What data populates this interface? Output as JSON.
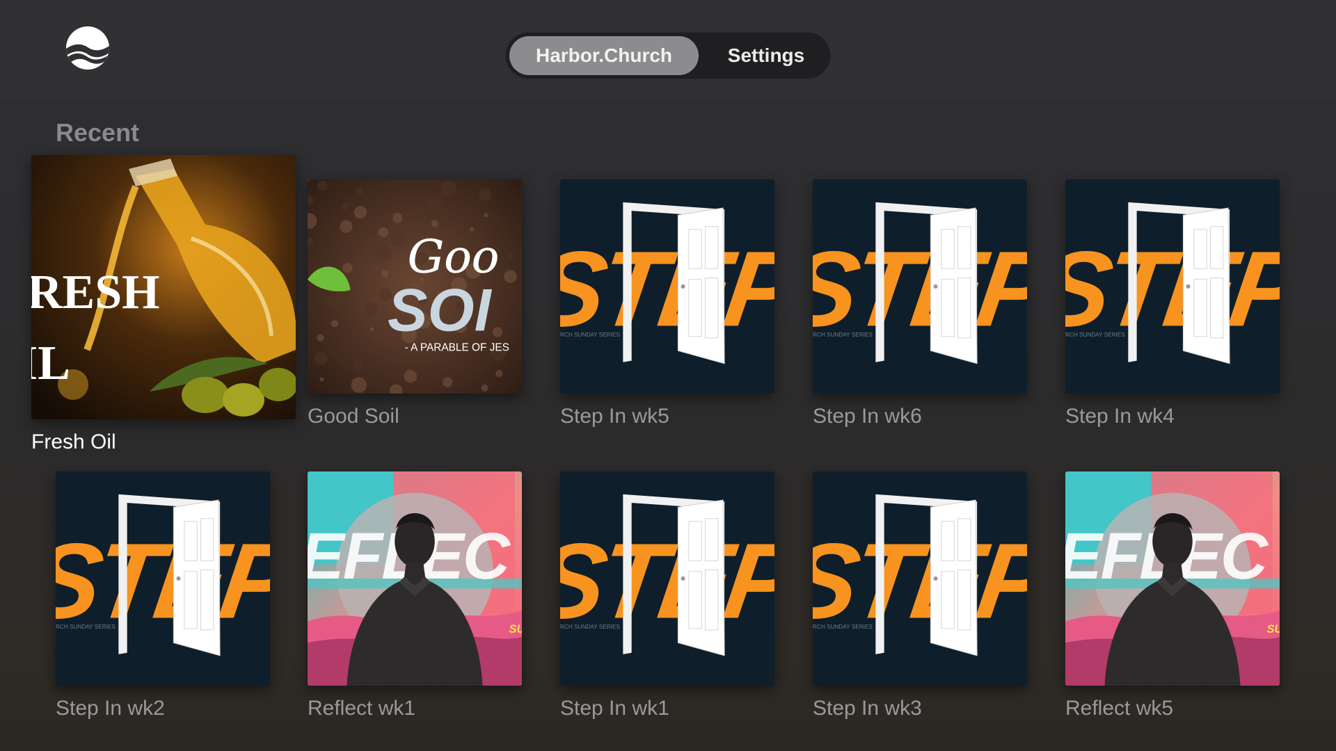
{
  "header": {
    "logo_icon": "wave-globe-icon",
    "tabs": [
      {
        "label": "Harbor.Church",
        "active": true
      },
      {
        "label": "Settings",
        "active": false
      }
    ]
  },
  "section": {
    "title": "Recent"
  },
  "artwork_text": {
    "fresh_oil_line1": "RESH",
    "fresh_oil_line2": "IL",
    "good_soil_script": "Goo",
    "good_soil_word": "SOI",
    "good_soil_sub": "- A PARABLE OF JES",
    "step_in_word": "STEP II",
    "step_in_sub": "RCH SUNDAY SERIES",
    "reflect_word": "EFLEC",
    "reflect_corner": "SU"
  },
  "items": [
    {
      "label": "Fresh Oil",
      "art": "fresh-oil",
      "focused": true
    },
    {
      "label": "Good Soil",
      "art": "good-soil",
      "focused": false
    },
    {
      "label": "Step In wk5",
      "art": "step-in",
      "focused": false
    },
    {
      "label": "Step In wk6",
      "art": "step-in",
      "focused": false
    },
    {
      "label": "Step In wk4",
      "art": "step-in",
      "focused": false
    },
    {
      "label": "Step In wk2",
      "art": "step-in",
      "focused": false
    },
    {
      "label": "Reflect wk1",
      "art": "reflect",
      "focused": false
    },
    {
      "label": "Step In wk1",
      "art": "step-in",
      "focused": false
    },
    {
      "label": "Step In wk3",
      "art": "step-in",
      "focused": false
    },
    {
      "label": "Reflect wk5",
      "art": "reflect",
      "focused": false
    }
  ],
  "colors": {
    "step_orange": "#f7931e",
    "step_bg": "#0f1e2b",
    "tab_active_bg": "#8c8c8e",
    "label_gray": "#9a9a9c"
  }
}
